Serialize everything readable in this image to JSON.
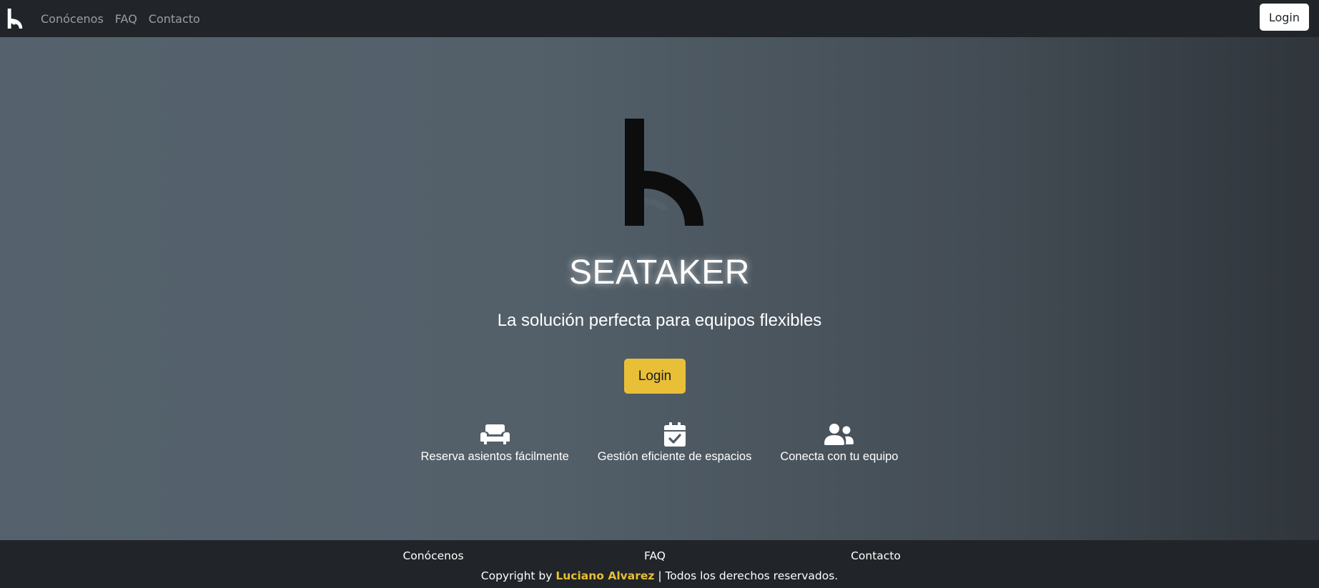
{
  "navbar": {
    "brand_icon": "seataker-logo-icon",
    "links": [
      "Conócenos",
      "FAQ",
      "Contacto"
    ],
    "login_label": "Login"
  },
  "hero": {
    "logo_icon": "seataker-logo-icon",
    "title": "SEATAKER",
    "subtitle": "La solución perfecta para equipos flexibles",
    "login_label": "Login",
    "accent_color": "#e8bf37",
    "features": [
      {
        "icon": "couch-icon",
        "label": "Reserva asientos fácilmente"
      },
      {
        "icon": "calendar-check-icon",
        "label": "Gestión eficiente de espacios"
      },
      {
        "icon": "users-icon",
        "label": "Conecta con tu equipo"
      }
    ]
  },
  "footer": {
    "links": [
      "Conócenos",
      "FAQ",
      "Contacto"
    ],
    "copyright_prefix": "Copyright by ",
    "author": "Luciano Alvarez",
    "copyright_suffix": " | Todos los derechos reservados."
  }
}
